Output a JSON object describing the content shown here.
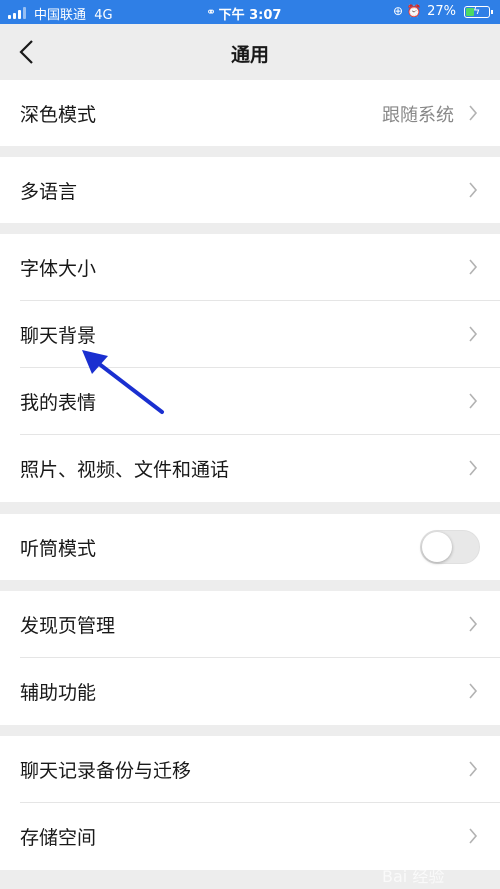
{
  "status_bar": {
    "carrier": "中国联通",
    "network": "4G",
    "time": "下午 3:07",
    "battery": "27%"
  },
  "nav": {
    "title": "通用"
  },
  "groups": [
    {
      "rows": [
        {
          "label": "深色模式",
          "value": "跟随系统"
        }
      ]
    },
    {
      "rows": [
        {
          "label": "多语言"
        }
      ]
    },
    {
      "rows": [
        {
          "label": "字体大小"
        },
        {
          "label": "聊天背景"
        },
        {
          "label": "我的表情"
        },
        {
          "label": "照片、视频、文件和通话"
        }
      ]
    },
    {
      "rows": [
        {
          "label": "听筒模式",
          "toggle": false
        }
      ]
    },
    {
      "rows": [
        {
          "label": "发现页管理"
        },
        {
          "label": "辅助功能"
        }
      ]
    },
    {
      "rows": [
        {
          "label": "聊天记录备份与迁移"
        },
        {
          "label": "存储空间"
        }
      ]
    }
  ],
  "colors": {
    "status_bar": "#2f7fe6",
    "annotation_arrow": "#1a2fd0",
    "background": "#ededed"
  },
  "watermark": {
    "text": "Bai 经验"
  }
}
